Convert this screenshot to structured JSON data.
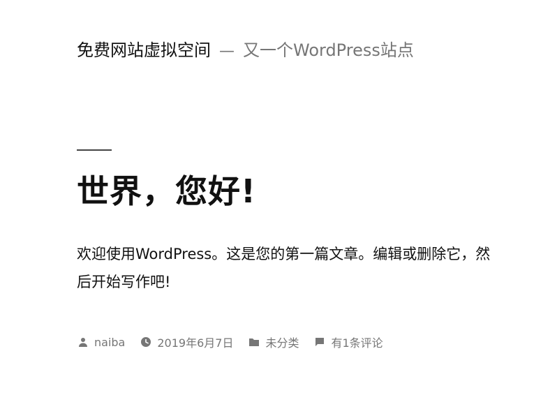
{
  "site": {
    "title": "免费网站虚拟空间",
    "separator": "—",
    "description": "又一个WordPress站点"
  },
  "post": {
    "title": "世界，您好!",
    "content": "欢迎使用WordPress。这是您的第一篇文章。编辑或删除它，然后开始写作吧!",
    "meta": {
      "author": "naiba",
      "date": "2019年6月7日",
      "category": "未分类",
      "comments": "有1条评论"
    }
  },
  "icons": {
    "author": "person-icon",
    "date": "clock-icon",
    "category": "folder-icon",
    "comments": "comment-icon"
  }
}
